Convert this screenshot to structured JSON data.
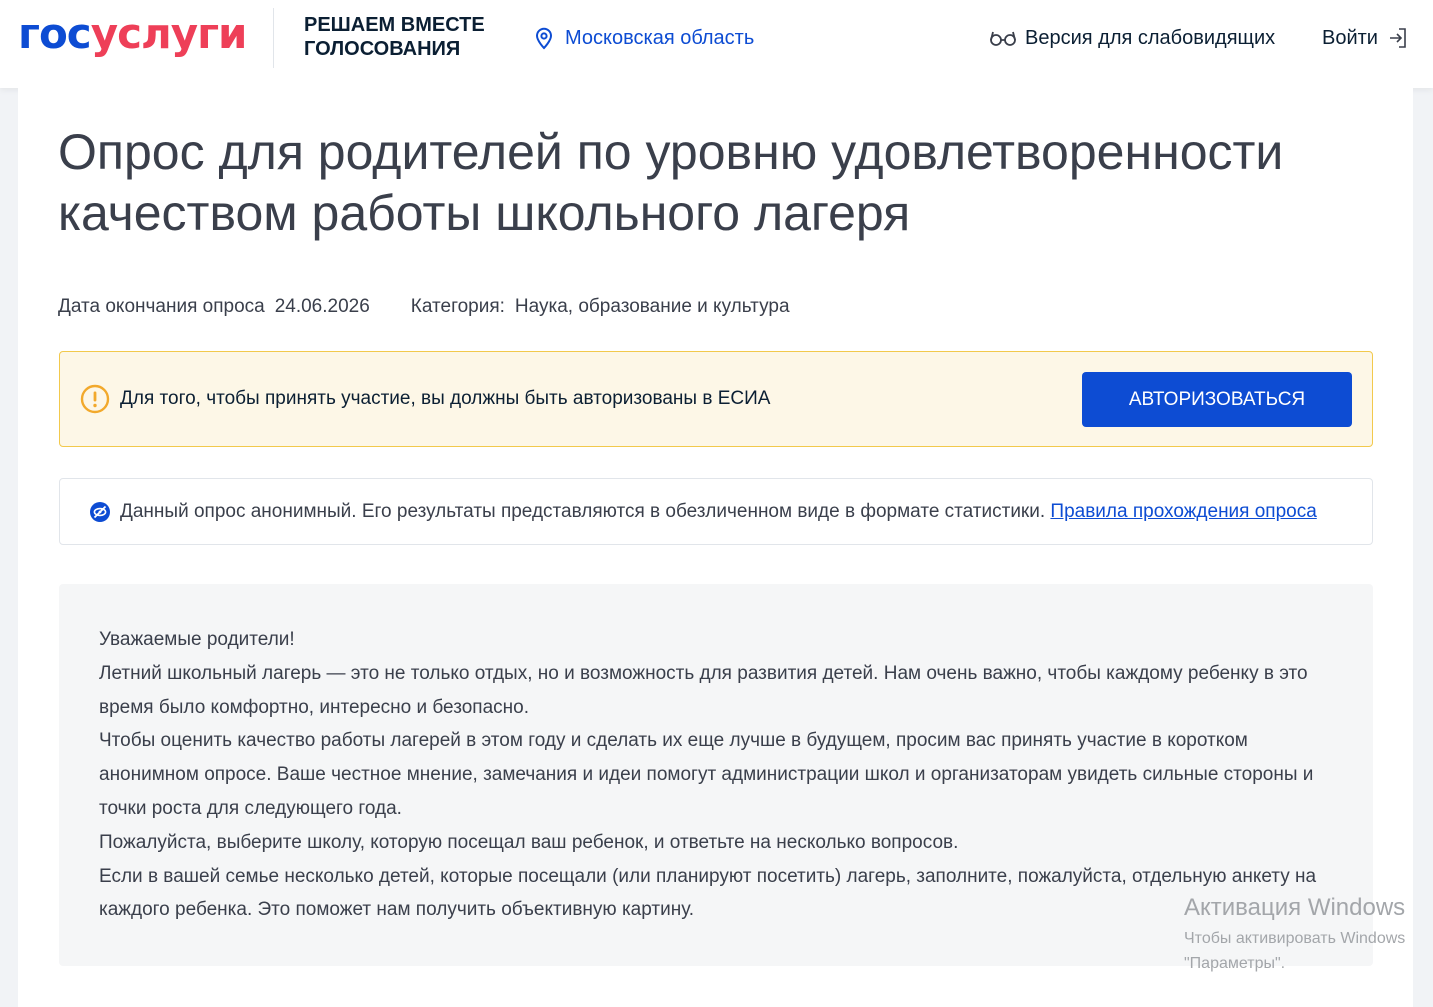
{
  "header": {
    "logo_part1": "гос",
    "logo_part2": "услуги",
    "tagline": "РЕШАЕМ ВМЕСТЕ ГОЛОСОВАНИЯ",
    "region": "Московская область",
    "accessibility": "Версия для слабовидящих",
    "login": "Войти"
  },
  "survey": {
    "title": "Опрос для родителей по уровню удовлетворенности качеством работы школьного лагеря",
    "end_date_label": "Дата окончания опроса",
    "end_date": "24.06.2026",
    "category_label": "Категория:",
    "category": "Наука, образование и культура"
  },
  "alert": {
    "text": "Для того, чтобы принять участие, вы должны быть авторизованы в ЕСИА",
    "button": "АВТОРИЗОВАТЬСЯ"
  },
  "notice": {
    "text": "Данный опрос анонимный. Его результаты представляются в обезличенном виде в формате статистики.",
    "link": "Правила прохождения опроса"
  },
  "intro": {
    "paragraphs": [
      "Уважаемые родители!",
      "Летний школьный лагерь — это не только отдых, но и возможность для развития детей. Нам очень важно, чтобы каждому ребенку в это время было комфортно, интересно и безопасно.",
      "Чтобы оценить качество работы лагерей в этом году и сделать их еще лучше в будущем, просим вас принять участие в коротком анонимном опросе. Ваше честное мнение, замечания и идеи помогут администрации школ и организаторам увидеть сильные стороны и точки роста для следующего года.",
      "Пожалуйста, выберите школу, которую посещал ваш ребенок, и ответьте на несколько вопросов.",
      "Если в вашей семье несколько детей, которые посещали (или планируют посетить) лагерь, заполните, пожалуйста, отдельную анкету на каждого ребенка. Это поможет нам получить объективную картину."
    ]
  },
  "watermark": {
    "title": "Активация Windows",
    "line1": "Чтобы активировать Windows",
    "line2": "\"Параметры\"."
  },
  "colors": {
    "brand_blue": "#0d4cd3",
    "brand_red": "#ee3f58",
    "alert_bg": "#fdf7e7",
    "alert_border": "#f2c94c",
    "warning_icon": "#f2a92c"
  },
  "icons": {
    "region": "location-pin-icon",
    "accessibility": "glasses-icon",
    "login": "login-arrow-icon",
    "alert": "warning-circle-icon",
    "notice": "anonymous-eye-icon"
  }
}
